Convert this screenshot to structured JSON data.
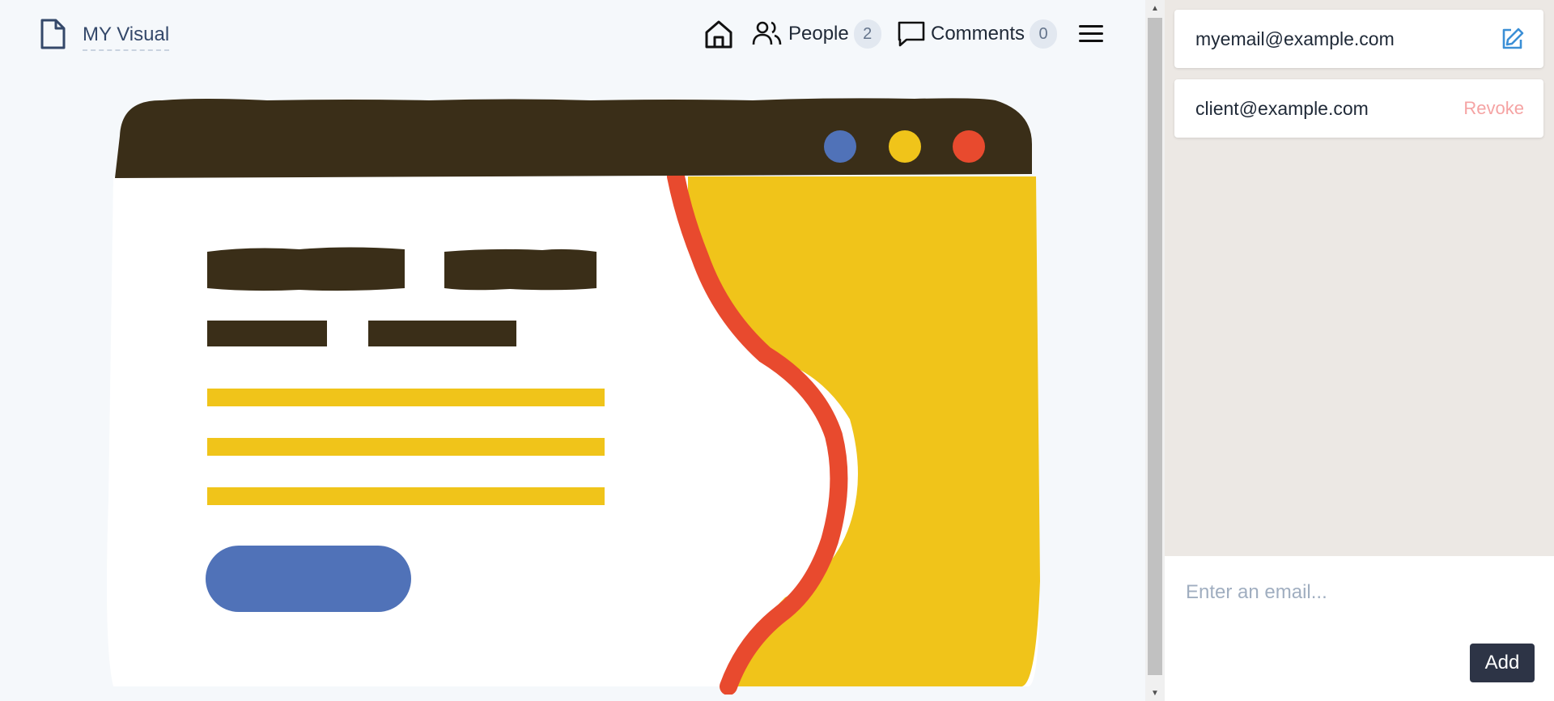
{
  "header": {
    "doc_title": "MY Visual",
    "people_label": "People",
    "people_count": "2",
    "comments_label": "Comments",
    "comments_count": "0"
  },
  "sharing": {
    "owner_email": "myemail@example.com",
    "members": [
      {
        "email": "client@example.com",
        "action": "Revoke"
      }
    ],
    "input_placeholder": "Enter an email...",
    "add_label": "Add"
  },
  "icons": {
    "doc": "file-icon",
    "home": "home-icon",
    "people": "people-icon",
    "comments": "comment-icon",
    "menu": "hamburger-menu-icon",
    "edit": "edit-icon"
  },
  "colors": {
    "accent_blue": "#3b8fd6",
    "revoke_pink": "#f5a3a3",
    "dark_button": "#2d3446",
    "illustration_dark": "#3a2e18",
    "illustration_yellow": "#f0c41a",
    "illustration_red": "#e84a2e",
    "illustration_blue": "#5072b8"
  }
}
